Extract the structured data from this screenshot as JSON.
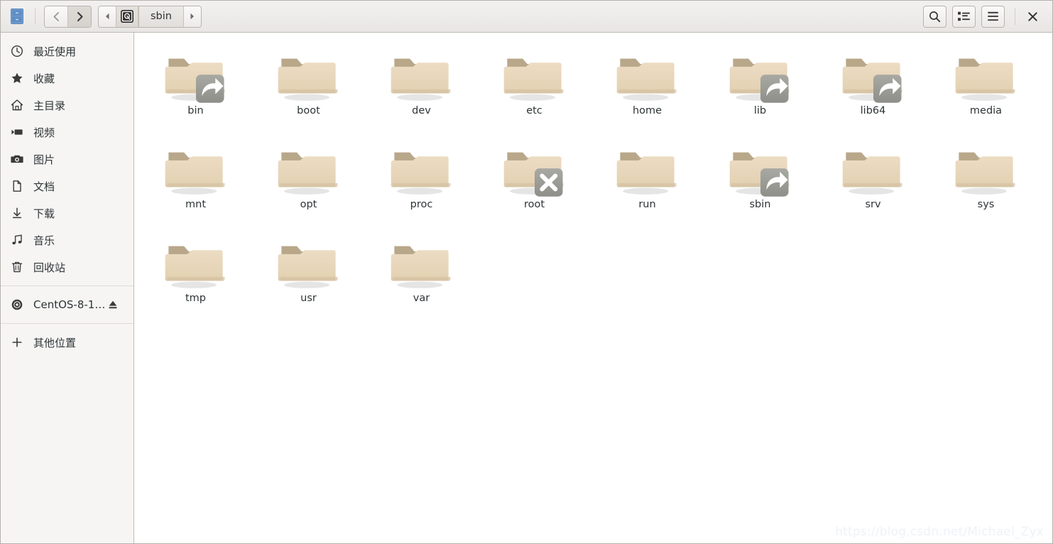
{
  "window": {
    "app_icon": "file-manager-icon",
    "close_label": "×"
  },
  "toolbar": {
    "back_label": "back-icon",
    "forward_label": "forward-icon",
    "path_prev_label": "path-scroll-left-icon",
    "path_next_label": "path-scroll-right-icon",
    "breadcrumbs": [
      {
        "label": "",
        "icon": "hard-disk-icon",
        "type": "icon",
        "current": false
      },
      {
        "label": "sbin",
        "icon": "",
        "type": "text",
        "current": true
      }
    ],
    "search_label": "search-icon",
    "view_toggle_label": "list-view-icon",
    "menu_label": "hamburger-menu-icon"
  },
  "sidebar": {
    "items": [
      {
        "label": "最近使用",
        "icon": "clock-icon"
      },
      {
        "label": "收藏",
        "icon": "star-icon"
      },
      {
        "label": "主目录",
        "icon": "home-icon"
      },
      {
        "label": "视频",
        "icon": "video-icon"
      },
      {
        "label": "图片",
        "icon": "camera-icon"
      },
      {
        "label": "文档",
        "icon": "document-icon"
      },
      {
        "label": "下载",
        "icon": "download-icon"
      },
      {
        "label": "音乐",
        "icon": "music-icon"
      },
      {
        "label": "回收站",
        "icon": "trash-icon"
      }
    ],
    "devices": [
      {
        "label": "CentOS-8-1…",
        "icon": "optical-disc-icon",
        "eject": "eject-icon"
      }
    ],
    "other": [
      {
        "label": "其他位置",
        "icon": "plus-icon"
      }
    ]
  },
  "main": {
    "files": [
      {
        "name": "bin",
        "type": "folder",
        "emblem": "symlink"
      },
      {
        "name": "boot",
        "type": "folder",
        "emblem": ""
      },
      {
        "name": "dev",
        "type": "folder",
        "emblem": ""
      },
      {
        "name": "etc",
        "type": "folder",
        "emblem": ""
      },
      {
        "name": "home",
        "type": "folder",
        "emblem": ""
      },
      {
        "name": "lib",
        "type": "folder",
        "emblem": "symlink"
      },
      {
        "name": "lib64",
        "type": "folder",
        "emblem": "symlink"
      },
      {
        "name": "media",
        "type": "folder",
        "emblem": ""
      },
      {
        "name": "mnt",
        "type": "folder",
        "emblem": ""
      },
      {
        "name": "opt",
        "type": "folder",
        "emblem": ""
      },
      {
        "name": "proc",
        "type": "folder",
        "emblem": ""
      },
      {
        "name": "root",
        "type": "folder",
        "emblem": "unreadable"
      },
      {
        "name": "run",
        "type": "folder",
        "emblem": ""
      },
      {
        "name": "sbin",
        "type": "folder",
        "emblem": "symlink"
      },
      {
        "name": "srv",
        "type": "folder",
        "emblem": ""
      },
      {
        "name": "sys",
        "type": "folder",
        "emblem": ""
      },
      {
        "name": "tmp",
        "type": "folder",
        "emblem": ""
      },
      {
        "name": "usr",
        "type": "folder",
        "emblem": ""
      },
      {
        "name": "var",
        "type": "folder",
        "emblem": ""
      }
    ]
  },
  "watermark": {
    "text": "https://blog.csdn.net/Michael_Zyx"
  },
  "colors": {
    "folder_front": "#e8d7bb",
    "folder_back": "#b3a084",
    "emblem_gray": "#9b9b96",
    "sidebar_bg": "#f6f5f4",
    "header_bg": "#edebe9",
    "text": "#2e3436"
  }
}
